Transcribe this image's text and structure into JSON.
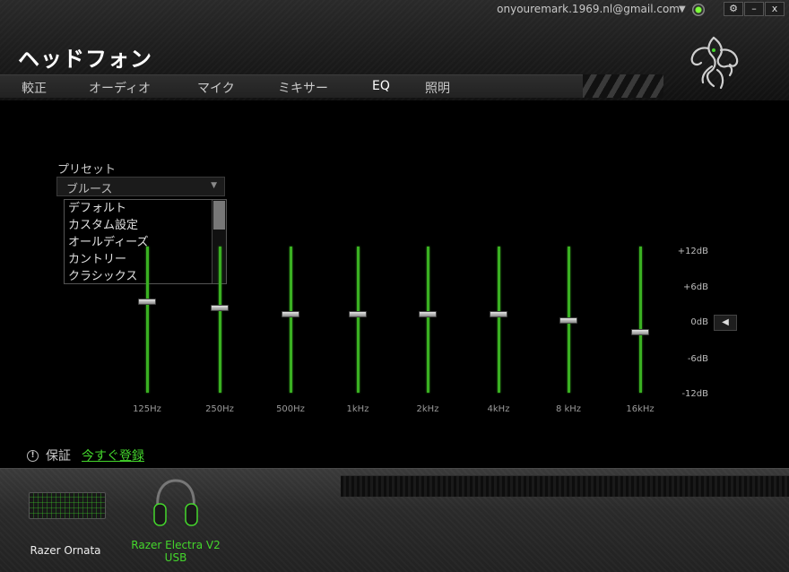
{
  "window": {
    "account_email": "onyouremark.1969.nl@gmail.com",
    "buttons": {
      "settings": "⚙",
      "minimize": "–",
      "close": "x"
    }
  },
  "page": {
    "title": "ヘッドフォン"
  },
  "tabs": [
    {
      "label": "較正"
    },
    {
      "label": "オーディオ"
    },
    {
      "label": "マイク"
    },
    {
      "label": "ミキサー"
    },
    {
      "label": "EQ"
    },
    {
      "label": "照明"
    }
  ],
  "preset": {
    "label": "プリセット",
    "selected": "ブルース",
    "options": [
      "デフォルト",
      "カスタム設定",
      "オールディーズ",
      "カントリー",
      "クラシックス"
    ]
  },
  "eq": {
    "bands": [
      {
        "freq": "125Hz",
        "gain_db": 3
      },
      {
        "freq": "250Hz",
        "gain_db": 2
      },
      {
        "freq": "500Hz",
        "gain_db": 1
      },
      {
        "freq": "1kHz",
        "gain_db": 1
      },
      {
        "freq": "2kHz",
        "gain_db": 1
      },
      {
        "freq": "4kHz",
        "gain_db": 1
      },
      {
        "freq": "8 kHz",
        "gain_db": 0
      },
      {
        "freq": "16kHz",
        "gain_db": -2
      }
    ],
    "scale_labels": [
      "+12dB",
      "+6dB",
      "0dB",
      "-6dB",
      "-12dB"
    ],
    "reset_icon": "◀"
  },
  "warranty": {
    "label": "保証",
    "link": "今すぐ登録",
    "icon": "!"
  },
  "devices": [
    {
      "name": "Razer Ornata",
      "active": false
    },
    {
      "name": "Razer Electra V2",
      "name2": "USB",
      "active": true
    }
  ],
  "colors": {
    "accent": "#44d62c",
    "slider_track": "#3ab022"
  }
}
